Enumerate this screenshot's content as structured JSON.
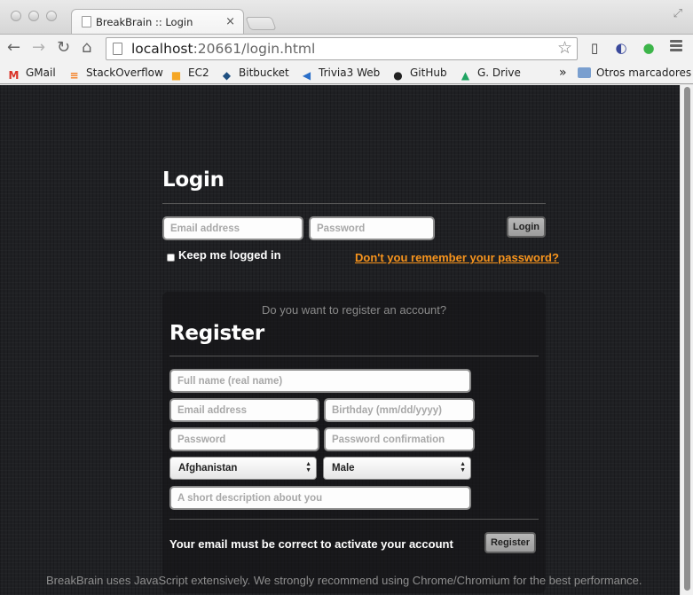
{
  "browser": {
    "tab_title": "BreakBrain :: Login",
    "tab_close": "×",
    "url_host": "localhost",
    "url_rest": ":20661/login.html",
    "bookmarks": [
      {
        "label": "GMail",
        "icon": "gmail-icon",
        "glyph": "M",
        "color": "#d93025"
      },
      {
        "label": "StackOverflow",
        "icon": "stackoverflow-icon",
        "glyph": "≡",
        "color": "#f48024"
      },
      {
        "label": "EC2",
        "icon": "aws-icon",
        "glyph": "■",
        "color": "#f5a623"
      },
      {
        "label": "Bitbucket",
        "icon": "bitbucket-icon",
        "glyph": "◆",
        "color": "#205081"
      },
      {
        "label": "Trivia3 Web",
        "icon": "trivia-icon",
        "glyph": "◀",
        "color": "#2a6fc9"
      },
      {
        "label": "GitHub",
        "icon": "github-icon",
        "glyph": "●",
        "color": "#222222"
      },
      {
        "label": "G. Drive",
        "icon": "gdrive-icon",
        "glyph": "▲",
        "color": "#1fa463"
      }
    ],
    "bookmarks_overflow": "»",
    "other_bookmarks": "Otros marcadores"
  },
  "login": {
    "title": "Login",
    "email_placeholder": "Email address",
    "password_placeholder": "Password",
    "login_button": "Login",
    "keep_logged_label": "Keep me logged in",
    "forgot_link": "Don't you remember your password?"
  },
  "register": {
    "question": "Do you want to register an account?",
    "title": "Register",
    "fullname_placeholder": "Full name (real name)",
    "email_placeholder": "Email address",
    "birthday_placeholder": "Birthday (mm/dd/yyyy)",
    "password_placeholder": "Password",
    "password_confirm_placeholder": "Password confirmation",
    "country_selected": "Afghanistan",
    "gender_selected": "Male",
    "description_placeholder": "A short description about you",
    "notice": "Your email must be correct to activate your account",
    "register_button": "Register"
  },
  "footer": {
    "note": "BreakBrain uses JavaScript extensively. We strongly recommend using Chrome/Chromium for the best performance."
  },
  "colors": {
    "page_bg": "#1f2023",
    "link_accent": "#f7941d"
  }
}
